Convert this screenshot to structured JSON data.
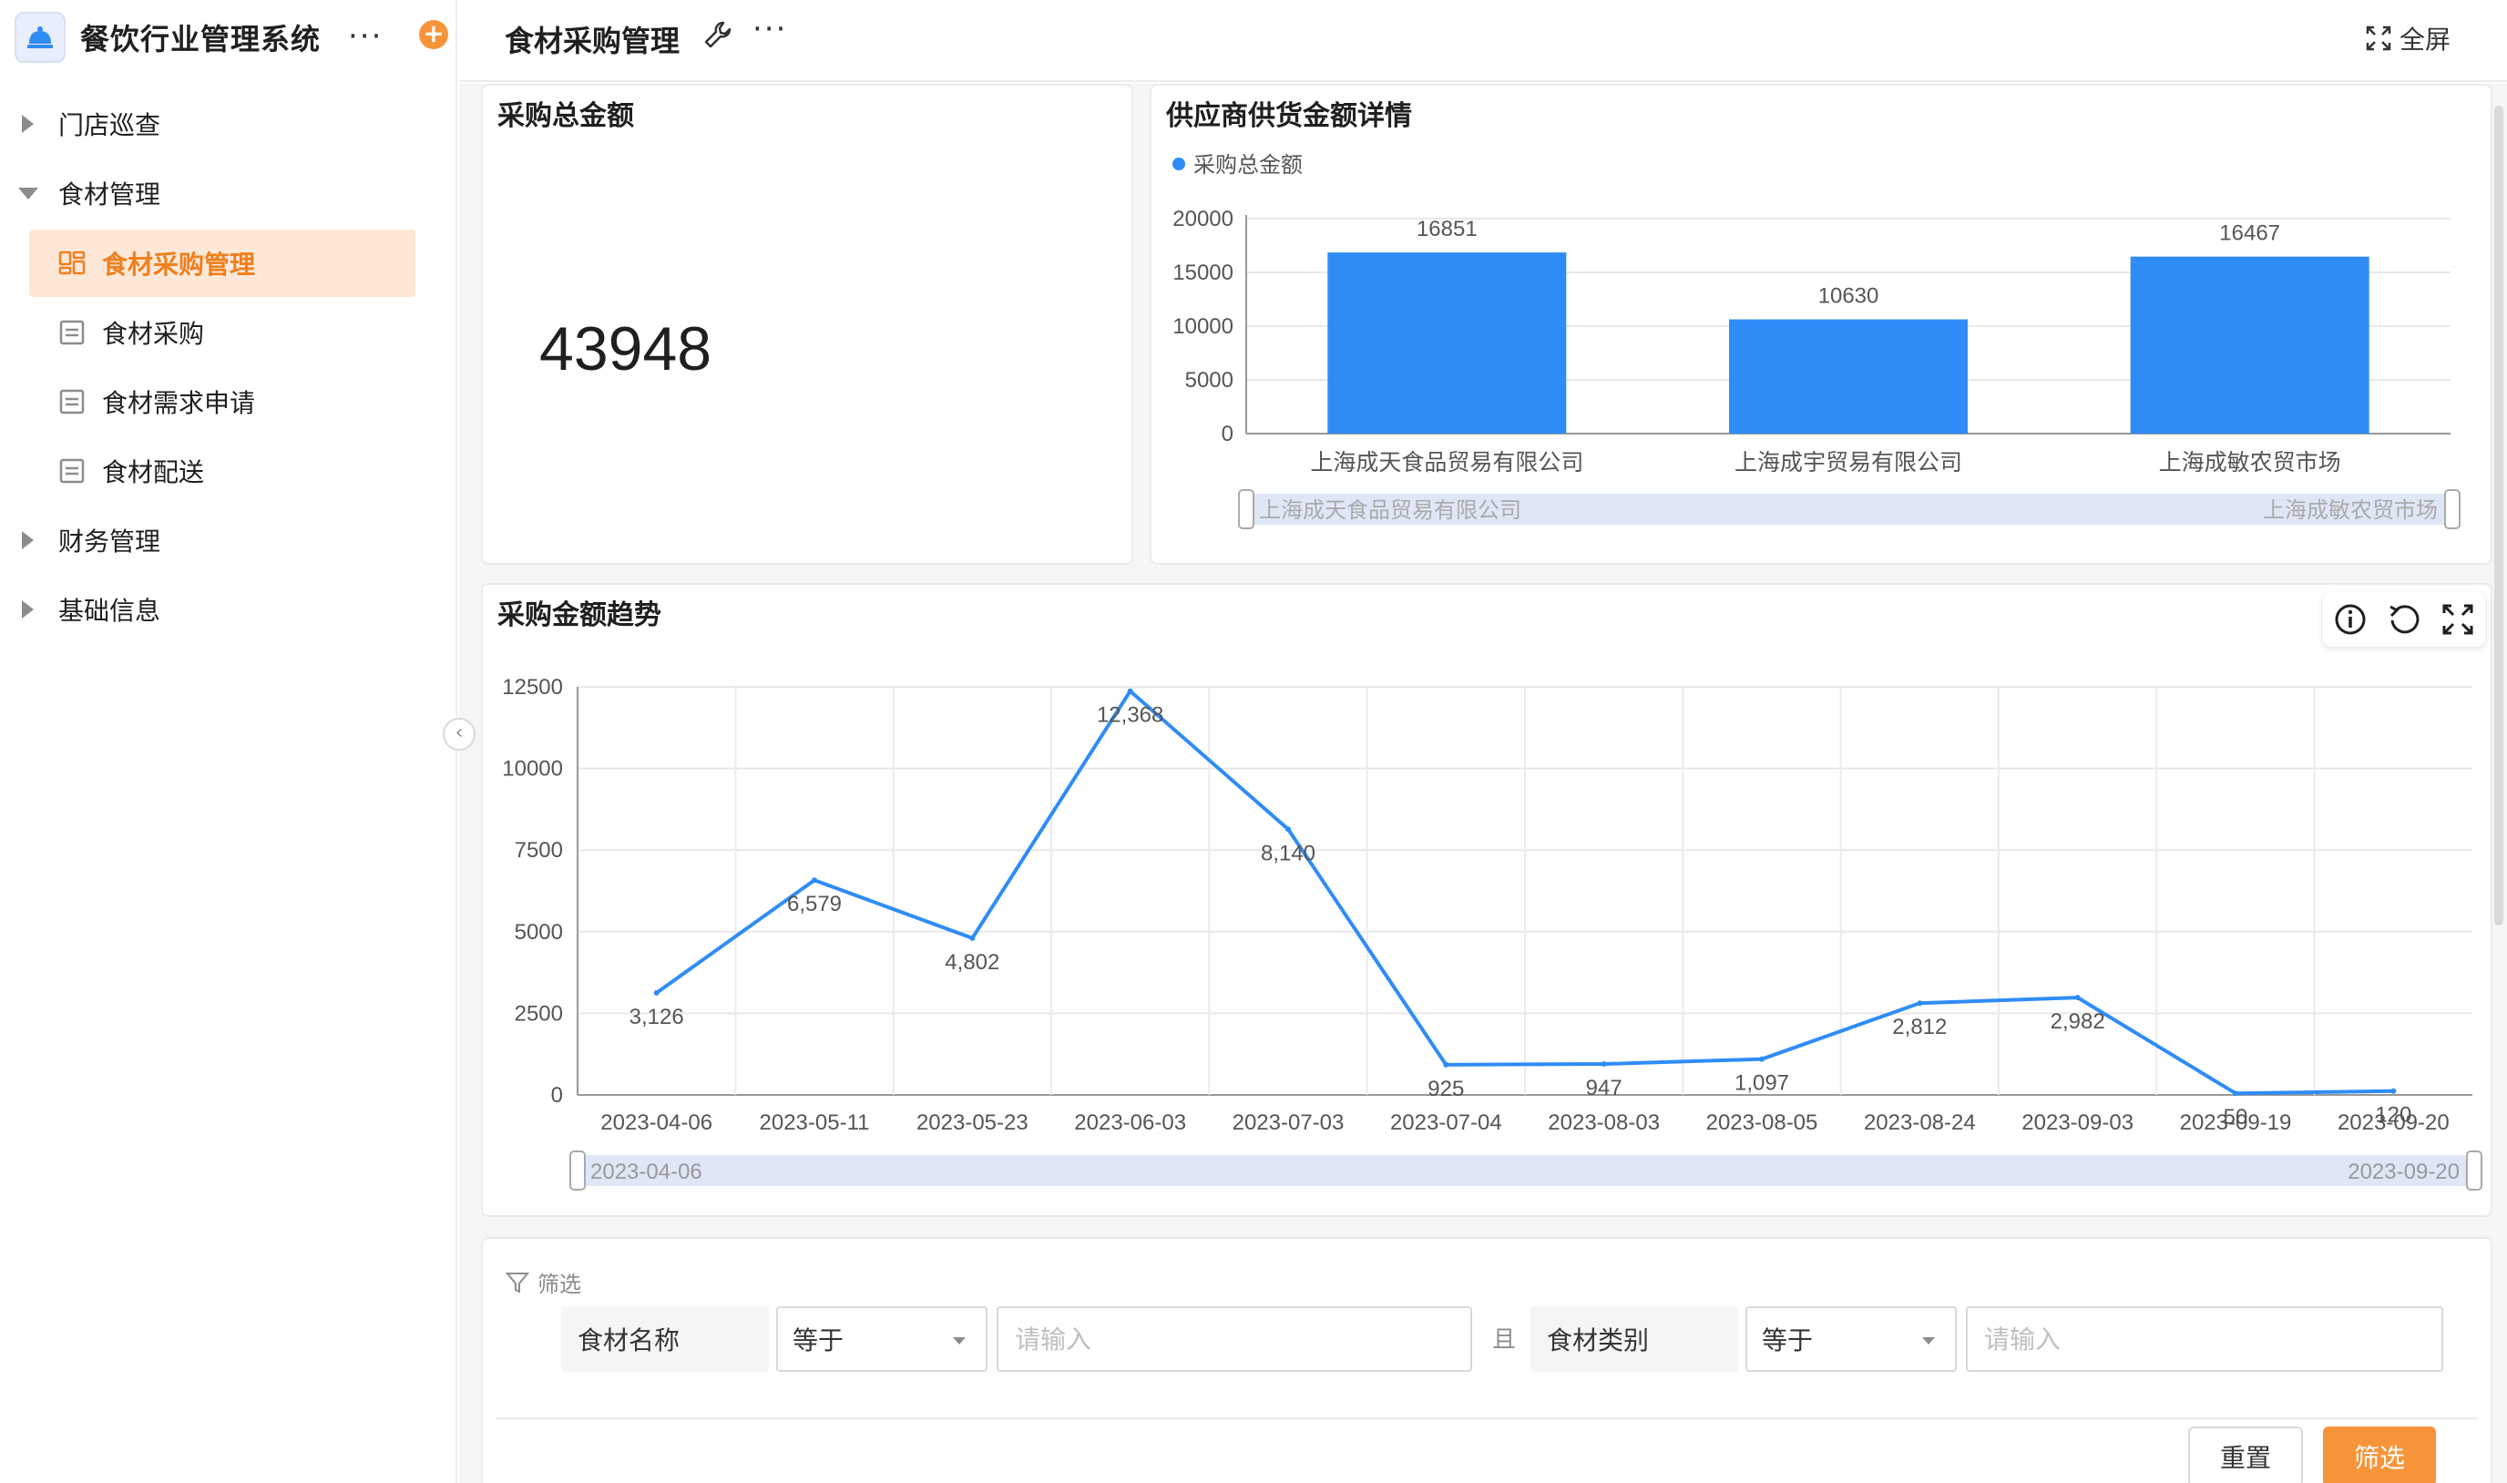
{
  "app": {
    "title": "餐饮行业管理系统",
    "more": "···",
    "add": "+"
  },
  "sidebar": {
    "groups": [
      {
        "label": "门店巡查",
        "expanded": false
      },
      {
        "label": "食材管理",
        "expanded": true
      },
      {
        "label": "财务管理",
        "expanded": false
      },
      {
        "label": "基础信息",
        "expanded": false
      }
    ],
    "items": [
      {
        "label": "食材采购管理",
        "active": true
      },
      {
        "label": "食材采购",
        "active": false
      },
      {
        "label": "食材需求申请",
        "active": false
      },
      {
        "label": "食材配送",
        "active": false
      }
    ],
    "collapse": "‹"
  },
  "header": {
    "title": "食材采购管理",
    "more": "···",
    "fullscreen_label": "全屏"
  },
  "cards": {
    "total": {
      "title": "采购总金额",
      "value": "43948"
    },
    "supplier": {
      "title": "供应商供货金额详情"
    },
    "trend": {
      "title": "采购金额趋势"
    }
  },
  "charts": {
    "supplier": {
      "type": "bar",
      "legend": "采购总金额",
      "categories": [
        "上海成天食品贸易有限公司",
        "上海成宇贸易有限公司",
        "上海成敏农贸市场"
      ],
      "values": [
        16851,
        10630,
        16467
      ],
      "y_ticks": [
        "20000",
        "15000",
        "10000",
        "5000",
        "0"
      ],
      "ylim": [
        0,
        20000
      ],
      "color": "#2f8cf6",
      "zoom_start": "上海成天食品贸易有限公司",
      "zoom_end": "上海成敏农贸市场"
    },
    "trend": {
      "type": "line",
      "categories": [
        "2023-04-06",
        "2023-05-11",
        "2023-05-23",
        "2023-06-03",
        "2023-07-03",
        "2023-07-04",
        "2023-08-03",
        "2023-08-05",
        "2023-08-24",
        "2023-09-03",
        "2023-09-19",
        "2023-09-20"
      ],
      "values": [
        3126,
        6579,
        4802,
        12368,
        8140,
        925,
        947,
        1097,
        2812,
        2982,
        50,
        120
      ],
      "labels": [
        "3,126",
        "6,579",
        "4,802",
        "12,368",
        "8,140",
        "925",
        "947",
        "1,097",
        "2,812",
        "2,982",
        "50",
        "120"
      ],
      "y_ticks": [
        "12500",
        "10000",
        "7500",
        "5000",
        "2500",
        "0"
      ],
      "ylim": [
        0,
        12500
      ],
      "color": "#2f8cf6",
      "zoom_start": "2023-04-06",
      "zoom_end": "2023-09-20"
    }
  },
  "filter": {
    "title": "筛选",
    "field1": {
      "label": "食材名称",
      "operator": "等于",
      "placeholder": "请输入"
    },
    "conjunction": "且",
    "field2": {
      "label": "食材类别",
      "operator": "等于",
      "placeholder": "请输入"
    },
    "reset_label": "重置",
    "submit_label": "筛选"
  }
}
